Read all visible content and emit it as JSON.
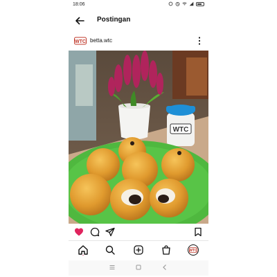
{
  "status_bar": {
    "time": "18:06"
  },
  "header": {
    "title": "Postingan"
  },
  "post": {
    "username": "betta.wtc",
    "avatar_text": "WTC",
    "jar_label": "WTC",
    "liked": true
  },
  "icons": {
    "back": "arrow-left-icon",
    "more": "more-vertical-icon",
    "like": "heart-icon",
    "comment": "comment-icon",
    "share": "send-icon",
    "save": "bookmark-icon",
    "home": "home-icon",
    "search": "search-icon",
    "create": "plus-square-icon",
    "shop": "shopping-bag-icon",
    "profile": "avatar-icon"
  },
  "colors": {
    "like": "#e0245e",
    "table": "#4fb83f",
    "food": "#d9952a"
  }
}
